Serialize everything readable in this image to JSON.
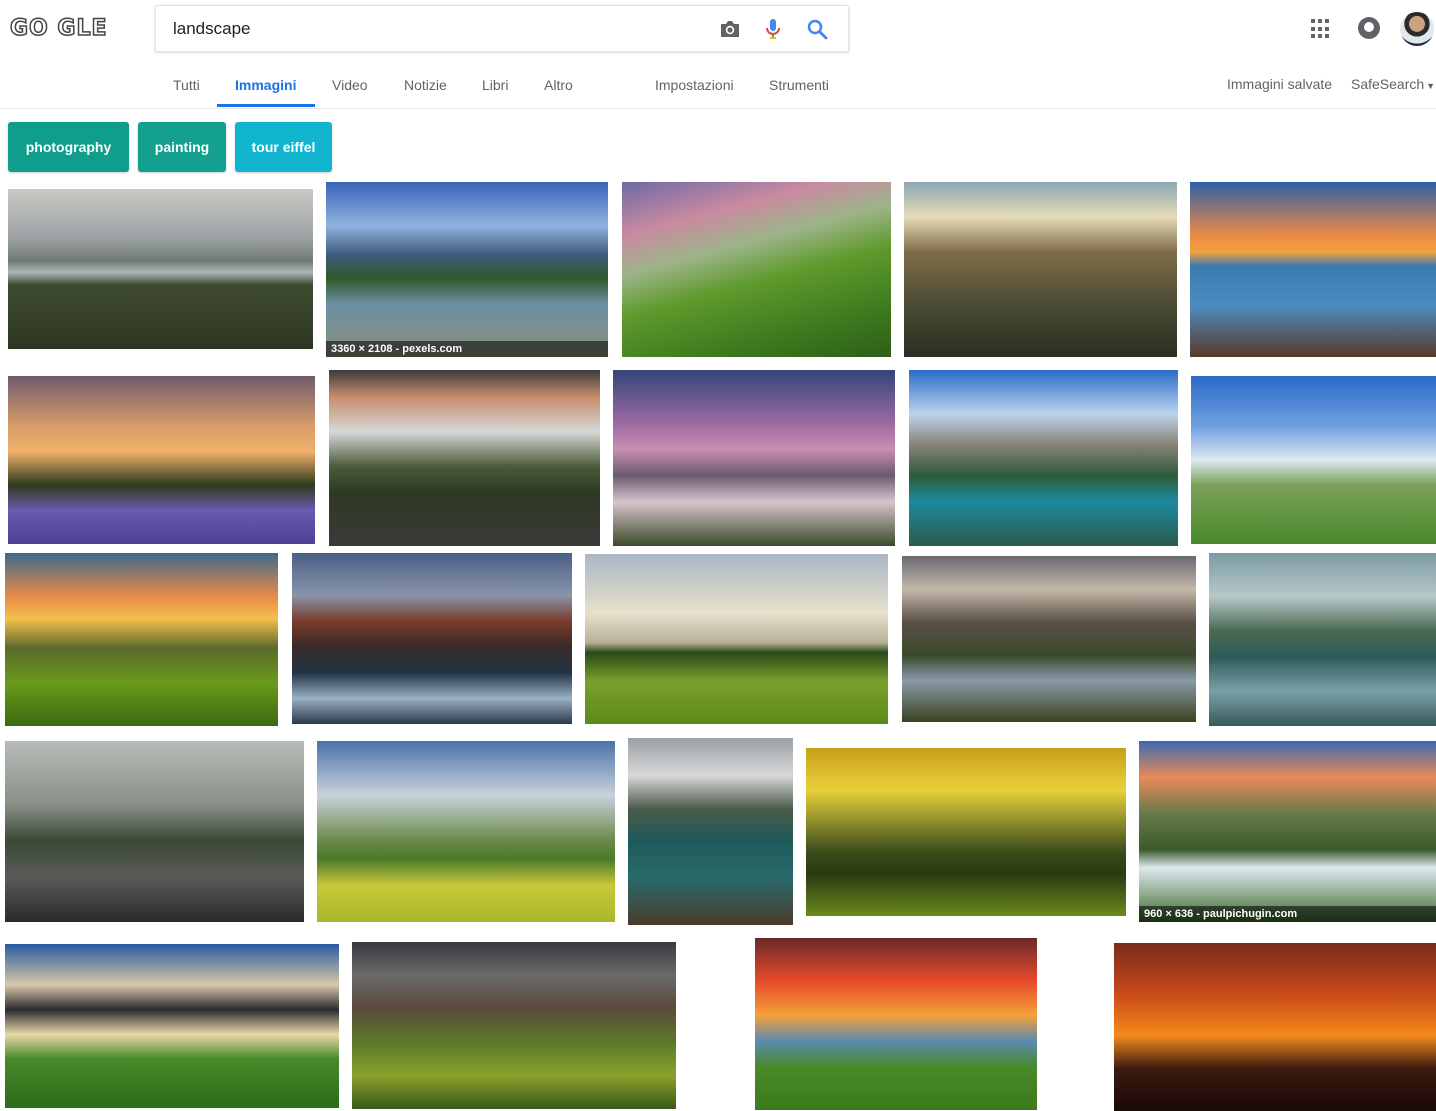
{
  "header": {
    "logo_text": "GO GLE",
    "search_value": "landscape",
    "icons": [
      "camera-icon",
      "microphone-icon",
      "search-icon",
      "apps-icon",
      "notifications-icon"
    ]
  },
  "nav": {
    "tabs": [
      "Tutti",
      "Immagini",
      "Video",
      "Notizie",
      "Libri",
      "Altro"
    ],
    "active_tab": "Immagini",
    "tools": [
      "Impostazioni",
      "Strumenti"
    ],
    "right": [
      "Immagini salvate",
      "SafeSearch"
    ]
  },
  "chips": [
    "photography",
    "painting",
    "tour eiffel"
  ],
  "captions": {
    "tile_2": "3360 × 2108 - pexels.com",
    "tile_20": "960 × 636 - paulpichugin.com"
  },
  "colors": {
    "accent": "#1a73e8",
    "chip_1": "#0f9d8c",
    "chip_2": "#13a08e",
    "chip_3": "#12b5cf"
  }
}
